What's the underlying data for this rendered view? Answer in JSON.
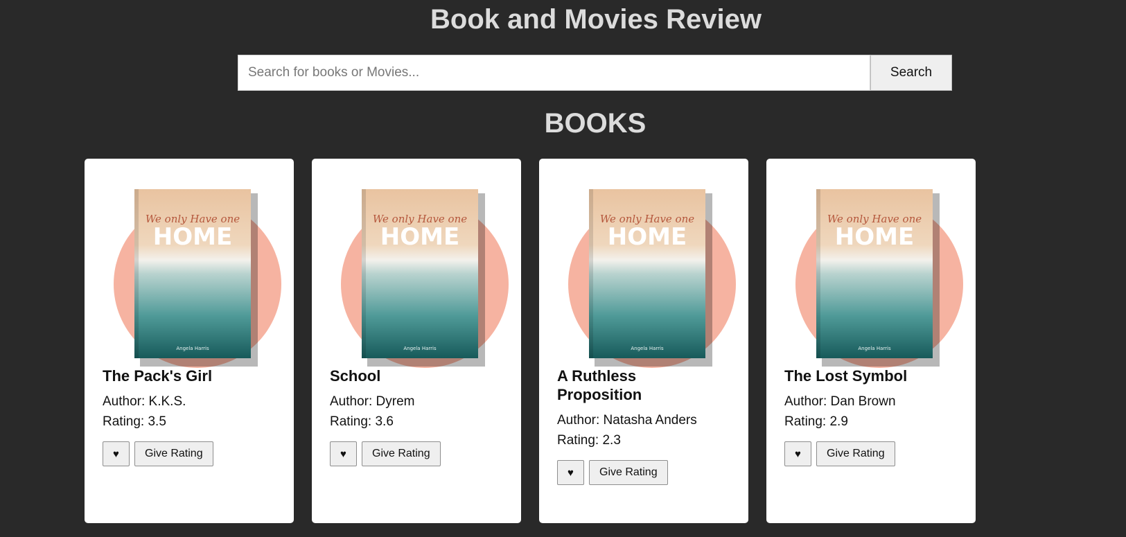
{
  "header": {
    "title": "Book and Movies Review"
  },
  "search": {
    "placeholder": "Search for books or Movies...",
    "value": "",
    "button_label": "Search"
  },
  "section": {
    "title": "BOOKS"
  },
  "cover": {
    "tagline": "We only Have one",
    "headline": "HOME",
    "author": "Angela Harris"
  },
  "books": [
    {
      "title": "The Pack's Girl",
      "author": "Author: K.K.S.",
      "rating": "Rating: 3.5",
      "like_label": "♥",
      "rate_label": "Give Rating"
    },
    {
      "title": "School",
      "author": "Author: Dyrem",
      "rating": "Rating: 3.6",
      "like_label": "♥",
      "rate_label": "Give Rating"
    },
    {
      "title": "A Ruthless Proposition",
      "author": "Author: Natasha Anders",
      "rating": "Rating: 2.3",
      "like_label": "♥",
      "rate_label": "Give Rating"
    },
    {
      "title": "The Lost Symbol",
      "author": "Author: Dan Brown",
      "rating": "Rating: 2.9",
      "like_label": "♥",
      "rate_label": "Give Rating"
    }
  ],
  "colors": {
    "background": "#292929",
    "card": "#ffffff",
    "accent_circle": "#f6b3a1"
  }
}
